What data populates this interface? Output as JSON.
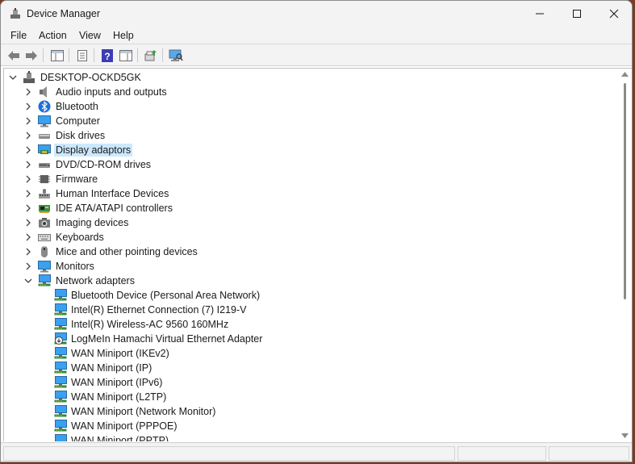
{
  "window": {
    "title": "Device Manager"
  },
  "menu": [
    "File",
    "Action",
    "View",
    "Help"
  ],
  "tree": {
    "root": "DESKTOP-OCKD5GK",
    "categories": [
      {
        "label": "Audio inputs and outputs",
        "icon": "speaker-icon"
      },
      {
        "label": "Bluetooth",
        "icon": "bluetooth-icon"
      },
      {
        "label": "Computer",
        "icon": "computer-icon"
      },
      {
        "label": "Disk drives",
        "icon": "disk-drive-icon"
      },
      {
        "label": "Display adaptors",
        "icon": "display-adapter-icon",
        "selected": true
      },
      {
        "label": "DVD/CD-ROM drives",
        "icon": "dvd-drive-icon"
      },
      {
        "label": "Firmware",
        "icon": "firmware-icon"
      },
      {
        "label": "Human Interface Devices",
        "icon": "hid-icon"
      },
      {
        "label": "IDE ATA/ATAPI controllers",
        "icon": "ide-controller-icon"
      },
      {
        "label": "Imaging devices",
        "icon": "imaging-device-icon"
      },
      {
        "label": "Keyboards",
        "icon": "keyboard-icon"
      },
      {
        "label": "Mice and other pointing devices",
        "icon": "mouse-icon"
      },
      {
        "label": "Monitors",
        "icon": "monitor-icon"
      },
      {
        "label": "Network adapters",
        "icon": "network-adapter-icon",
        "expanded": true
      }
    ],
    "network_children": [
      "Bluetooth Device (Personal Area Network)",
      "Intel(R) Ethernet Connection (7) I219-V",
      "Intel(R) Wireless-AC 9560 160MHz",
      "LogMeIn Hamachi Virtual Ethernet Adapter",
      "WAN Miniport (IKEv2)",
      "WAN Miniport (IP)",
      "WAN Miniport (IPv6)",
      "WAN Miniport (L2TP)",
      "WAN Miniport (Network Monitor)",
      "WAN Miniport (PPPOE)",
      "WAN Miniport (PPTP)"
    ]
  },
  "colors": {
    "selection": "#cce8ff",
    "accent": "#1e88d6"
  }
}
